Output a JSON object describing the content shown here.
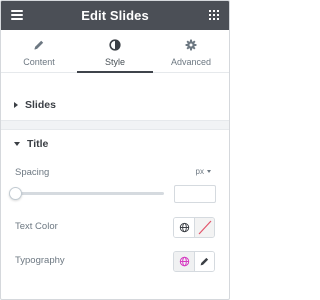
{
  "header": {
    "title": "Edit Slides"
  },
  "tabs": [
    {
      "label": "Content",
      "icon": "pencil-icon"
    },
    {
      "label": "Style",
      "icon": "half-circle-icon",
      "active": true
    },
    {
      "label": "Advanced",
      "icon": "gear-icon"
    }
  ],
  "sections": {
    "slides": {
      "label": "Slides",
      "state": "collapsed"
    },
    "title": {
      "label": "Title",
      "state": "expanded",
      "spacing": {
        "label": "Spacing",
        "unit": "px",
        "value": ""
      },
      "text_color": {
        "label": "Text Color"
      },
      "typography": {
        "label": "Typography"
      }
    }
  },
  "colors": {
    "header_bg": "#4b4f56",
    "accent_magenta": "#d63cc2",
    "clear_red": "#e2546a"
  }
}
